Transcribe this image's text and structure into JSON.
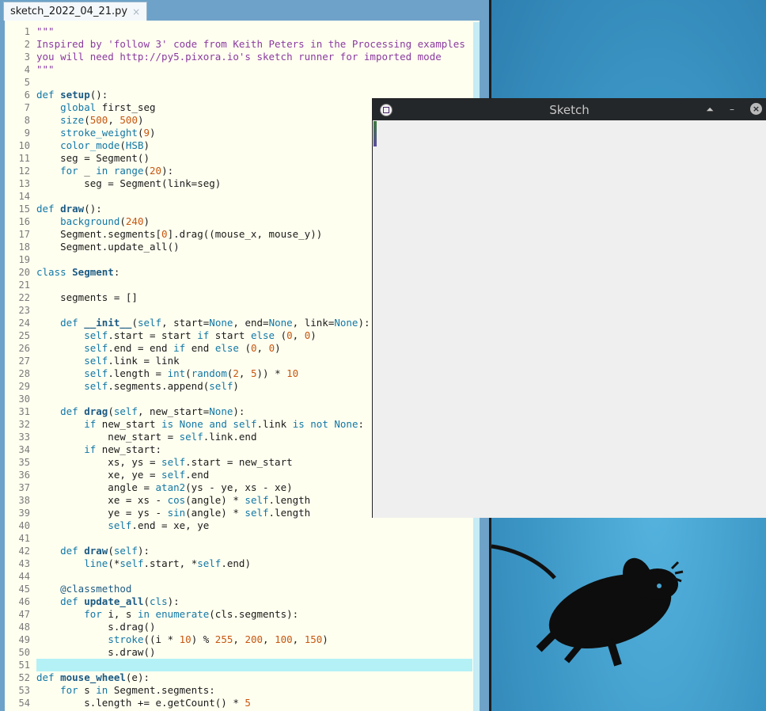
{
  "ide": {
    "tab_label": "sketch_2022_04_21.py",
    "tab_close": "×",
    "highlighted_line": 51,
    "lines": [
      [
        {
          "t": "\"\"\"",
          "c": "str"
        }
      ],
      [
        {
          "t": "Inspired by 'follow 3' code from Keith Peters in the Processing examples",
          "c": "str"
        }
      ],
      [
        {
          "t": "you will need http://py5.pixora.io's sketch runner for imported mode",
          "c": "str"
        }
      ],
      [
        {
          "t": "\"\"\"",
          "c": "str"
        }
      ],
      [],
      [
        {
          "t": "def ",
          "c": "kw"
        },
        {
          "t": "setup",
          "c": "fn"
        },
        {
          "t": "():"
        }
      ],
      [
        {
          "t": "    "
        },
        {
          "t": "global",
          "c": "kw"
        },
        {
          "t": " first_seg"
        }
      ],
      [
        {
          "t": "    "
        },
        {
          "t": "size",
          "c": "bi"
        },
        {
          "t": "("
        },
        {
          "t": "500",
          "c": "num"
        },
        {
          "t": ", "
        },
        {
          "t": "500",
          "c": "num"
        },
        {
          "t": ")"
        }
      ],
      [
        {
          "t": "    "
        },
        {
          "t": "stroke_weight",
          "c": "bi"
        },
        {
          "t": "("
        },
        {
          "t": "9",
          "c": "num"
        },
        {
          "t": ")"
        }
      ],
      [
        {
          "t": "    "
        },
        {
          "t": "color_mode",
          "c": "bi"
        },
        {
          "t": "("
        },
        {
          "t": "HSB",
          "c": "bi"
        },
        {
          "t": ")"
        }
      ],
      [
        {
          "t": "    seg = Segment()"
        }
      ],
      [
        {
          "t": "    "
        },
        {
          "t": "for",
          "c": "kw"
        },
        {
          "t": " _ "
        },
        {
          "t": "in",
          "c": "kw"
        },
        {
          "t": " "
        },
        {
          "t": "range",
          "c": "bi"
        },
        {
          "t": "("
        },
        {
          "t": "20",
          "c": "num"
        },
        {
          "t": "):"
        }
      ],
      [
        {
          "t": "        seg = Segment(link=seg)"
        }
      ],
      [],
      [
        {
          "t": "def ",
          "c": "kw"
        },
        {
          "t": "draw",
          "c": "fn"
        },
        {
          "t": "():"
        }
      ],
      [
        {
          "t": "    "
        },
        {
          "t": "background",
          "c": "bi"
        },
        {
          "t": "("
        },
        {
          "t": "240",
          "c": "num"
        },
        {
          "t": ")"
        }
      ],
      [
        {
          "t": "    Segment.segments["
        },
        {
          "t": "0",
          "c": "num"
        },
        {
          "t": "].drag((mouse_x, mouse_y))"
        }
      ],
      [
        {
          "t": "    Segment.update_all()"
        }
      ],
      [],
      [
        {
          "t": "class ",
          "c": "kw"
        },
        {
          "t": "Segment",
          "c": "fn"
        },
        {
          "t": ":"
        }
      ],
      [],
      [
        {
          "t": "    segments = []"
        }
      ],
      [],
      [
        {
          "t": "    "
        },
        {
          "t": "def ",
          "c": "kw"
        },
        {
          "t": "__init__",
          "c": "fn"
        },
        {
          "t": "("
        },
        {
          "t": "self",
          "c": "self"
        },
        {
          "t": ", start="
        },
        {
          "t": "None",
          "c": "kw"
        },
        {
          "t": ", end="
        },
        {
          "t": "None",
          "c": "kw"
        },
        {
          "t": ", link="
        },
        {
          "t": "None",
          "c": "kw"
        },
        {
          "t": "):"
        }
      ],
      [
        {
          "t": "        "
        },
        {
          "t": "self",
          "c": "self"
        },
        {
          "t": ".start = start "
        },
        {
          "t": "if",
          "c": "kw"
        },
        {
          "t": " start "
        },
        {
          "t": "else",
          "c": "kw"
        },
        {
          "t": " ("
        },
        {
          "t": "0",
          "c": "num"
        },
        {
          "t": ", "
        },
        {
          "t": "0",
          "c": "num"
        },
        {
          "t": ")"
        }
      ],
      [
        {
          "t": "        "
        },
        {
          "t": "self",
          "c": "self"
        },
        {
          "t": ".end = end "
        },
        {
          "t": "if",
          "c": "kw"
        },
        {
          "t": " end "
        },
        {
          "t": "else",
          "c": "kw"
        },
        {
          "t": " ("
        },
        {
          "t": "0",
          "c": "num"
        },
        {
          "t": ", "
        },
        {
          "t": "0",
          "c": "num"
        },
        {
          "t": ")"
        }
      ],
      [
        {
          "t": "        "
        },
        {
          "t": "self",
          "c": "self"
        },
        {
          "t": ".link = link"
        }
      ],
      [
        {
          "t": "        "
        },
        {
          "t": "self",
          "c": "self"
        },
        {
          "t": ".length = "
        },
        {
          "t": "int",
          "c": "bi"
        },
        {
          "t": "("
        },
        {
          "t": "random",
          "c": "bi"
        },
        {
          "t": "("
        },
        {
          "t": "2",
          "c": "num"
        },
        {
          "t": ", "
        },
        {
          "t": "5",
          "c": "num"
        },
        {
          "t": ")) * "
        },
        {
          "t": "10",
          "c": "num"
        }
      ],
      [
        {
          "t": "        "
        },
        {
          "t": "self",
          "c": "self"
        },
        {
          "t": ".segments.append("
        },
        {
          "t": "self",
          "c": "self"
        },
        {
          "t": ")"
        }
      ],
      [],
      [
        {
          "t": "    "
        },
        {
          "t": "def ",
          "c": "kw"
        },
        {
          "t": "drag",
          "c": "fn"
        },
        {
          "t": "("
        },
        {
          "t": "self",
          "c": "self"
        },
        {
          "t": ", new_start="
        },
        {
          "t": "None",
          "c": "kw"
        },
        {
          "t": "):"
        }
      ],
      [
        {
          "t": "        "
        },
        {
          "t": "if",
          "c": "kw"
        },
        {
          "t": " new_start "
        },
        {
          "t": "is",
          "c": "kw"
        },
        {
          "t": " "
        },
        {
          "t": "None",
          "c": "kw"
        },
        {
          "t": " "
        },
        {
          "t": "and",
          "c": "kw"
        },
        {
          "t": " "
        },
        {
          "t": "self",
          "c": "self"
        },
        {
          "t": ".link "
        },
        {
          "t": "is not",
          "c": "kw"
        },
        {
          "t": " "
        },
        {
          "t": "None",
          "c": "kw"
        },
        {
          "t": ":"
        }
      ],
      [
        {
          "t": "            new_start = "
        },
        {
          "t": "self",
          "c": "self"
        },
        {
          "t": ".link.end"
        }
      ],
      [
        {
          "t": "        "
        },
        {
          "t": "if",
          "c": "kw"
        },
        {
          "t": " new_start:"
        }
      ],
      [
        {
          "t": "            xs, ys = "
        },
        {
          "t": "self",
          "c": "self"
        },
        {
          "t": ".start = new_start"
        }
      ],
      [
        {
          "t": "            xe, ye = "
        },
        {
          "t": "self",
          "c": "self"
        },
        {
          "t": ".end"
        }
      ],
      [
        {
          "t": "            angle = "
        },
        {
          "t": "atan2",
          "c": "bi"
        },
        {
          "t": "(ys - ye, xs - xe)"
        }
      ],
      [
        {
          "t": "            xe = xs - "
        },
        {
          "t": "cos",
          "c": "bi"
        },
        {
          "t": "(angle) * "
        },
        {
          "t": "self",
          "c": "self"
        },
        {
          "t": ".length"
        }
      ],
      [
        {
          "t": "            ye = ys - "
        },
        {
          "t": "sin",
          "c": "bi"
        },
        {
          "t": "(angle) * "
        },
        {
          "t": "self",
          "c": "self"
        },
        {
          "t": ".length"
        }
      ],
      [
        {
          "t": "            "
        },
        {
          "t": "self",
          "c": "self"
        },
        {
          "t": ".end = xe, ye"
        }
      ],
      [],
      [
        {
          "t": "    "
        },
        {
          "t": "def ",
          "c": "kw"
        },
        {
          "t": "draw",
          "c": "fn"
        },
        {
          "t": "("
        },
        {
          "t": "self",
          "c": "self"
        },
        {
          "t": "):"
        }
      ],
      [
        {
          "t": "        "
        },
        {
          "t": "line",
          "c": "bi"
        },
        {
          "t": "(*"
        },
        {
          "t": "self",
          "c": "self"
        },
        {
          "t": ".start, *"
        },
        {
          "t": "self",
          "c": "self"
        },
        {
          "t": ".end)"
        }
      ],
      [],
      [
        {
          "t": "    "
        },
        {
          "t": "@classmethod",
          "c": "dec"
        }
      ],
      [
        {
          "t": "    "
        },
        {
          "t": "def ",
          "c": "kw"
        },
        {
          "t": "update_all",
          "c": "fn"
        },
        {
          "t": "("
        },
        {
          "t": "cls",
          "c": "self"
        },
        {
          "t": "):"
        }
      ],
      [
        {
          "t": "        "
        },
        {
          "t": "for",
          "c": "kw"
        },
        {
          "t": " i, s "
        },
        {
          "t": "in",
          "c": "kw"
        },
        {
          "t": " "
        },
        {
          "t": "enumerate",
          "c": "bi"
        },
        {
          "t": "(cls.segments):"
        }
      ],
      [
        {
          "t": "            s.drag()"
        }
      ],
      [
        {
          "t": "            "
        },
        {
          "t": "stroke",
          "c": "bi"
        },
        {
          "t": "((i * "
        },
        {
          "t": "10",
          "c": "num"
        },
        {
          "t": ") % "
        },
        {
          "t": "255",
          "c": "num"
        },
        {
          "t": ", "
        },
        {
          "t": "200",
          "c": "num"
        },
        {
          "t": ", "
        },
        {
          "t": "100",
          "c": "num"
        },
        {
          "t": ", "
        },
        {
          "t": "150",
          "c": "num"
        },
        {
          "t": ")"
        }
      ],
      [
        {
          "t": "            s.draw()"
        }
      ],
      [],
      [
        {
          "t": "def ",
          "c": "kw"
        },
        {
          "t": "mouse_wheel",
          "c": "fn"
        },
        {
          "t": "(e):"
        }
      ],
      [
        {
          "t": "    "
        },
        {
          "t": "for",
          "c": "kw"
        },
        {
          "t": " s "
        },
        {
          "t": "in",
          "c": "kw"
        },
        {
          "t": " Segment.segments:"
        }
      ],
      [
        {
          "t": "        s.length += e.getCount() * "
        },
        {
          "t": "5",
          "c": "num"
        }
      ]
    ]
  },
  "sketch_window": {
    "title": "Sketch",
    "btn_shade": "⏶",
    "btn_minimize": "–",
    "btn_close": "×",
    "canvas_color": "#efefef"
  },
  "colors": {
    "editor_bg": "#fffff0",
    "current_line": "#b3f1f7",
    "keyword": "#1177a6",
    "number": "#c7560f",
    "string": "#8a3aa0"
  }
}
